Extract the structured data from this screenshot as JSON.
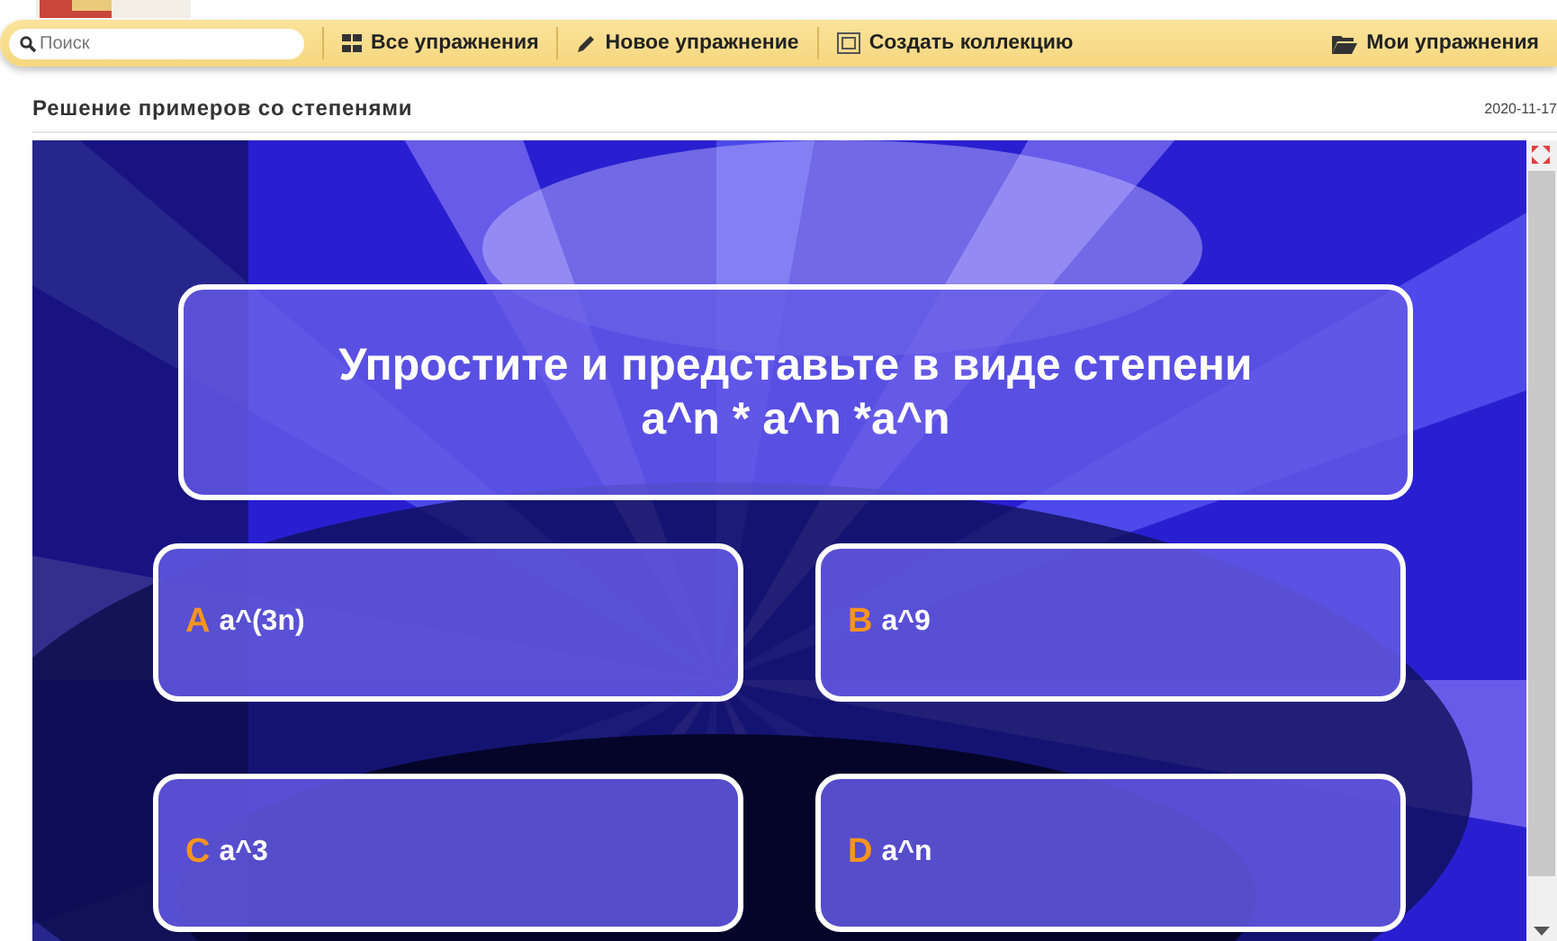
{
  "toolbar": {
    "search": {
      "placeholder": "Поиск"
    },
    "items": [
      {
        "label": "Все упражнения",
        "kind": "grid"
      },
      {
        "label": "Новое упражнение",
        "kind": "pencil"
      },
      {
        "label": "Создать коллекцию",
        "kind": "collection"
      }
    ],
    "right_item": {
      "label": "Мои упражнения",
      "kind": "folder"
    }
  },
  "header": {
    "title": "Решение примеров со степенями",
    "date": "2020-11-17"
  },
  "quiz": {
    "question": "Упростите и представьте в виде степени\na^n * a^n *a^n",
    "answers": [
      {
        "letter": "A",
        "text": "a^(3n)"
      },
      {
        "letter": "B",
        "text": "a^9"
      },
      {
        "letter": "C",
        "text": "a^3"
      },
      {
        "letter": "D",
        "text": "a^n"
      }
    ]
  }
}
